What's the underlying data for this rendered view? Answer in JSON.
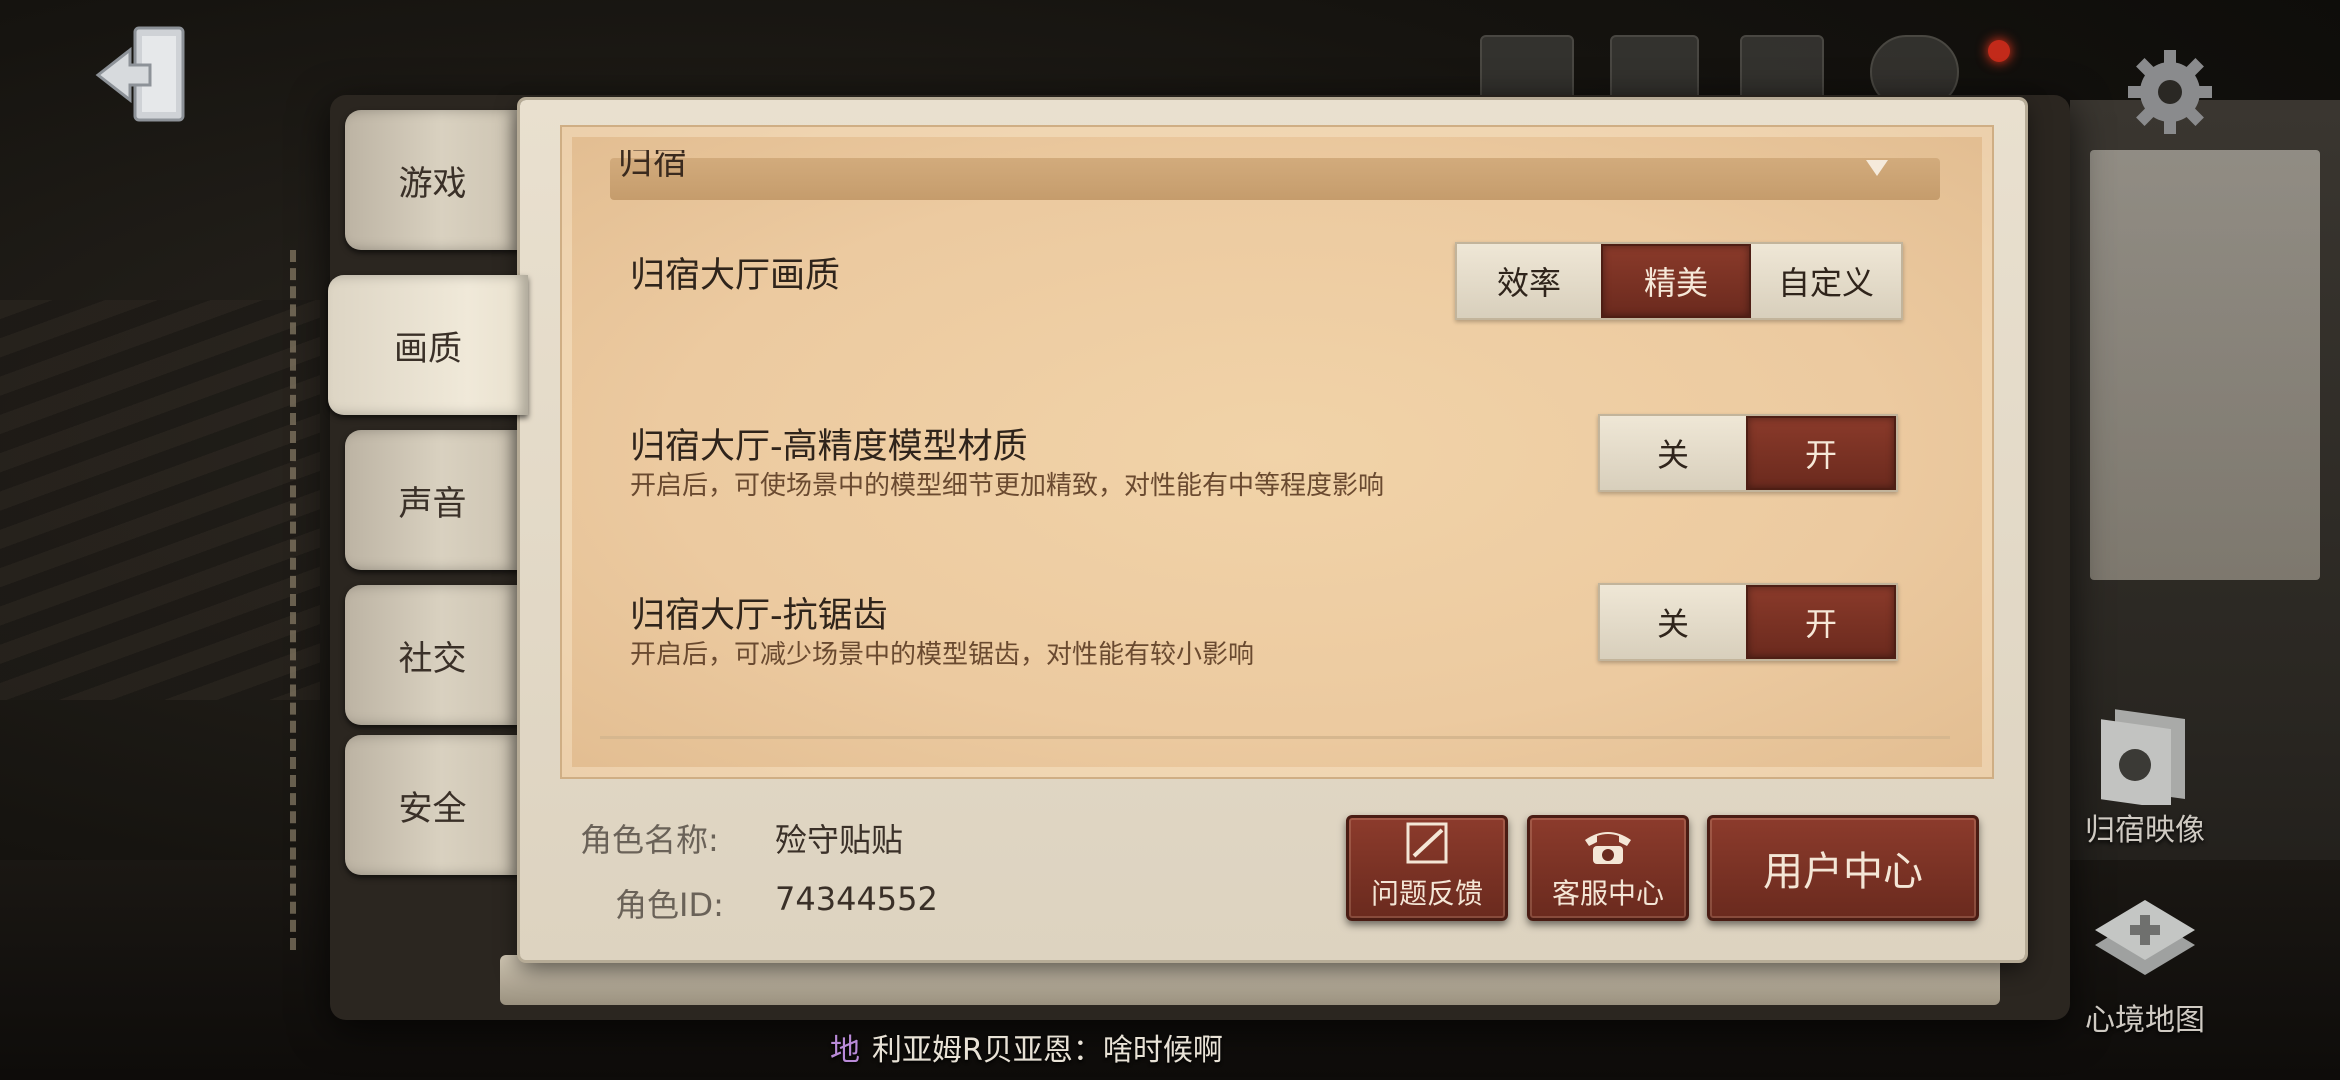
{
  "tabs": [
    {
      "label": "游戏"
    },
    {
      "label": "画质"
    },
    {
      "label": "声音"
    },
    {
      "label": "社交"
    },
    {
      "label": "安全"
    }
  ],
  "active_tab": "画质",
  "section": {
    "title": "归宿"
  },
  "settings": [
    {
      "title": "归宿大厅画质",
      "options": [
        "效率",
        "精美",
        "自定义"
      ],
      "selected": "精美"
    },
    {
      "title": "归宿大厅-高精度模型材质",
      "desc": "开启后，可使场景中的模型细节更加精致，对性能有中等程度影响",
      "options": [
        "关",
        "开"
      ],
      "selected": "开"
    },
    {
      "title": "归宿大厅-抗锯齿",
      "desc": "开启后，可减少场景中的模型锯齿，对性能有较小影响",
      "options": [
        "关",
        "开"
      ],
      "selected": "开"
    }
  ],
  "profile": {
    "name_label": "角色名称:",
    "name_value": "殓守贴贴",
    "id_label": "角色ID:",
    "id_value": "74344552"
  },
  "buttons": {
    "feedback": "问题反馈",
    "service": "客服中心",
    "user_center": "用户中心"
  },
  "shortcuts": {
    "video": "归宿映像",
    "map": "心境地图"
  },
  "chat": {
    "tag": "地",
    "text": "利亚姆R贝亚恩：啥时候啊"
  },
  "colors": {
    "accent": "#7a3324",
    "paper": "#ecca9f"
  }
}
